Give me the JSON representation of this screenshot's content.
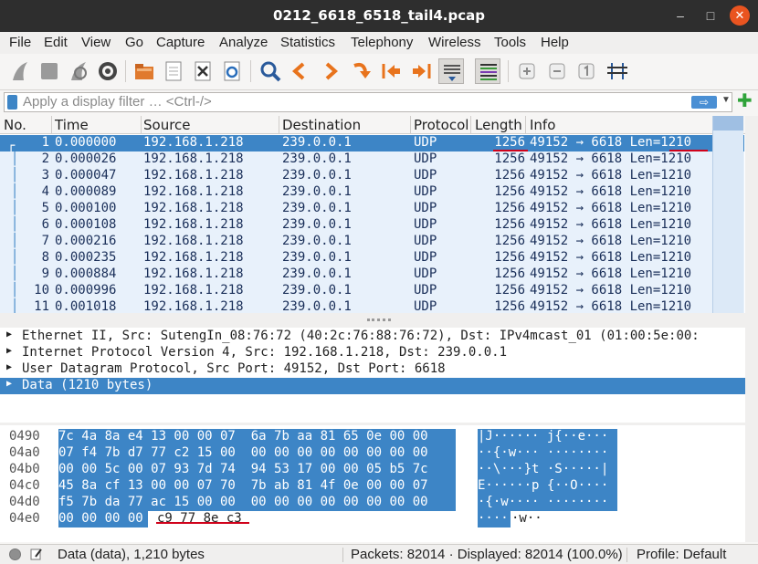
{
  "window": {
    "title": "0212_6618_6518_tail4.pcap"
  },
  "menu": [
    "File",
    "Edit",
    "View",
    "Go",
    "Capture",
    "Analyze",
    "Statistics",
    "Telephony",
    "Wireless",
    "Tools",
    "Help"
  ],
  "toolbar": {
    "icons": [
      "shark-fin-start-icon",
      "stop-capture-icon",
      "restart-capture-icon",
      "capture-options-icon",
      "open-file-icon",
      "save-file-icon",
      "close-file-icon",
      "reload-file-icon",
      "find-packet-icon",
      "go-back-icon",
      "go-forward-icon",
      "go-to-packet-icon",
      "go-first-icon",
      "go-last-icon",
      "autoscroll-icon",
      "colorize-icon",
      "zoom-in-icon",
      "zoom-out-icon",
      "normal-size-icon",
      "resize-columns-icon"
    ]
  },
  "filter": {
    "placeholder": "Apply a display filter … <Ctrl-/>"
  },
  "packet_list": {
    "columns": [
      "No.",
      "Time",
      "Source",
      "Destination",
      "Protocol",
      "Length",
      "Info"
    ],
    "rows": [
      {
        "no": "1",
        "time": "0.000000",
        "src": "192.168.1.218",
        "dst": "239.0.0.1",
        "proto": "UDP",
        "len": "1256",
        "info": "49152 → 6618 Len=1210"
      },
      {
        "no": "2",
        "time": "0.000026",
        "src": "192.168.1.218",
        "dst": "239.0.0.1",
        "proto": "UDP",
        "len": "1256",
        "info": "49152 → 6618 Len=1210"
      },
      {
        "no": "3",
        "time": "0.000047",
        "src": "192.168.1.218",
        "dst": "239.0.0.1",
        "proto": "UDP",
        "len": "1256",
        "info": "49152 → 6618 Len=1210"
      },
      {
        "no": "4",
        "time": "0.000089",
        "src": "192.168.1.218",
        "dst": "239.0.0.1",
        "proto": "UDP",
        "len": "1256",
        "info": "49152 → 6618 Len=1210"
      },
      {
        "no": "5",
        "time": "0.000100",
        "src": "192.168.1.218",
        "dst": "239.0.0.1",
        "proto": "UDP",
        "len": "1256",
        "info": "49152 → 6618 Len=1210"
      },
      {
        "no": "6",
        "time": "0.000108",
        "src": "192.168.1.218",
        "dst": "239.0.0.1",
        "proto": "UDP",
        "len": "1256",
        "info": "49152 → 6618 Len=1210"
      },
      {
        "no": "7",
        "time": "0.000216",
        "src": "192.168.1.218",
        "dst": "239.0.0.1",
        "proto": "UDP",
        "len": "1256",
        "info": "49152 → 6618 Len=1210"
      },
      {
        "no": "8",
        "time": "0.000235",
        "src": "192.168.1.218",
        "dst": "239.0.0.1",
        "proto": "UDP",
        "len": "1256",
        "info": "49152 → 6618 Len=1210"
      },
      {
        "no": "9",
        "time": "0.000884",
        "src": "192.168.1.218",
        "dst": "239.0.0.1",
        "proto": "UDP",
        "len": "1256",
        "info": "49152 → 6618 Len=1210"
      },
      {
        "no": "10",
        "time": "0.000996",
        "src": "192.168.1.218",
        "dst": "239.0.0.1",
        "proto": "UDP",
        "len": "1256",
        "info": "49152 → 6618 Len=1210"
      },
      {
        "no": "11",
        "time": "0.001018",
        "src": "192.168.1.218",
        "dst": "239.0.0.1",
        "proto": "UDP",
        "len": "1256",
        "info": "49152 → 6618 Len=1210"
      }
    ]
  },
  "details": [
    "Ethernet II, Src: SutengIn_08:76:72 (40:2c:76:88:76:72), Dst: IPv4mcast_01 (01:00:5e:00:",
    "Internet Protocol Version 4, Src: 192.168.1.218, Dst: 239.0.0.1",
    "User Datagram Protocol, Src Port: 49152, Dst Port: 6618",
    "Data (1210 bytes)"
  ],
  "bytes": [
    {
      "off": "0490",
      "hex1": "7c 4a 8a e4 13 00 00 07",
      "hex2": "6a 7b aa 81 65 0e 00 00",
      "ascii": "|J······ j{··e···"
    },
    {
      "off": "04a0",
      "hex1": "07 f4 7b d7 77 c2 15 00",
      "hex2": "00 00 00 00 00 00 00 00",
      "ascii": "··{·w··· ········"
    },
    {
      "off": "04b0",
      "hex1": "00 00 5c 00 07 93 7d 74",
      "hex2": "94 53 17 00 00 05 b5 7c",
      "ascii": "··\\···}t ·S·····|"
    },
    {
      "off": "04c0",
      "hex1": "45 8a cf 13 00 00 07 70",
      "hex2": "7b ab 81 4f 0e 00 00 07",
      "ascii": "E······p {··O····"
    },
    {
      "off": "04d0",
      "hex1": "f5 7b da 77 ac 15 00 00",
      "hex2": "00 00 00 00 00 00 00 00",
      "ascii": "·{·w···· ········"
    },
    {
      "off": "04e0",
      "hex_sel": "00 00 00 00",
      "hex_rest": "c9 77 8e c3",
      "ascii_sel": "····",
      "ascii_rest": "·w··"
    }
  ],
  "status": {
    "left": "Data (data), 1,210 bytes",
    "packets": "Packets: 82014 · Displayed: 82014 (100.0%)",
    "profile": "Profile: Default"
  },
  "colors": {
    "selection": "#3d85c6",
    "row_bg": "#e8f1fb",
    "annotation": "#d0021b",
    "titlebar": "#2e2e2e",
    "close": "#e95420"
  }
}
